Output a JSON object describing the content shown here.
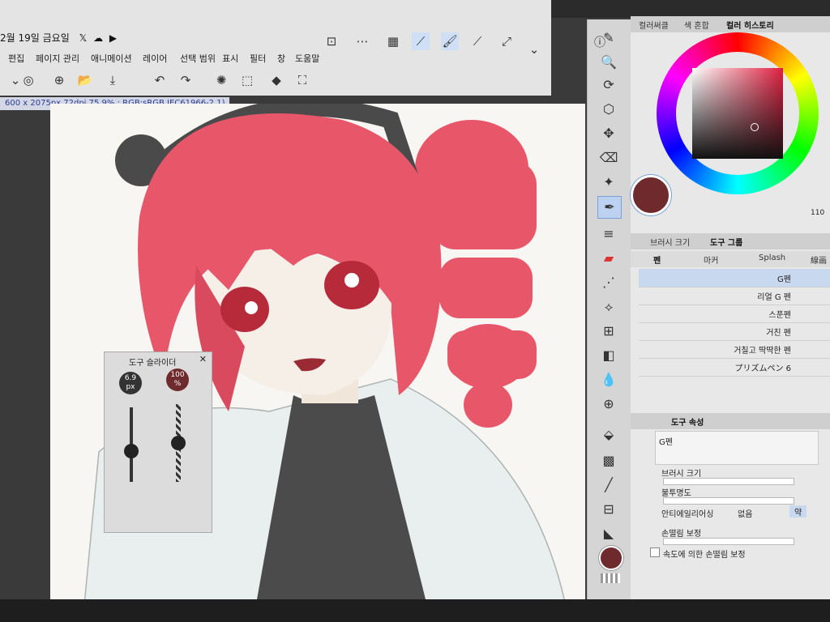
{
  "header": {
    "date": "2월 19일 금요일",
    "status_icons": [
      "x-icon",
      "cloud-icon",
      "youtube-icon"
    ]
  },
  "menu": [
    "편집",
    "페이지 관리",
    "애니메이션",
    "레이어",
    "선택 범위",
    "표시",
    "필터",
    "창",
    "도움말"
  ],
  "canvas_info": "600 x 2075px 72dpi 75.9% : RGB:sRGB IEC61966-2.1)",
  "tool_slider": {
    "title": "도구 슬라이더",
    "size_value": "6.9",
    "size_unit": "px",
    "opacity_value": "100",
    "opacity_unit": "%",
    "size_level": 0.4,
    "opacity_level": 1.0
  },
  "color_panel": {
    "tabs": [
      "컬러써클",
      "색 혼합",
      "컬러 히스토리"
    ],
    "selected_tab": "컬러 히스토리",
    "value_readout": "110",
    "main_color": "#6e2a2c",
    "ring_colors": [
      "#ff0000",
      "#ffff00",
      "#00ff00",
      "#00ffff",
      "#0000ff",
      "#ff00ff",
      "#ff0000"
    ]
  },
  "brush_panel": {
    "tabs": [
      "브러시 크기",
      "도구 그룹"
    ],
    "group_tabs": [
      "펜",
      "마커",
      "Splash",
      "線画"
    ],
    "brushes": [
      {
        "name": "G펜",
        "selected": true
      },
      {
        "name": "리얼 G 펜",
        "selected": false
      },
      {
        "name": "스푼펜",
        "selected": false
      },
      {
        "name": "거친 펜",
        "selected": false
      },
      {
        "name": "거칠고 딱딱한 펜",
        "selected": false
      },
      {
        "name": "プリズムペン 6",
        "selected": false
      }
    ]
  },
  "tool_property": {
    "title": "도구 속성",
    "brush_name": "G펜",
    "labels": {
      "brush_size": "브러시 크기",
      "opacity": "불투명도",
      "antialias": "안티에일리어싱",
      "antialias_none": "없음",
      "antialias_weak": "약",
      "stabilization": "손떨림 보정",
      "speed_stabilization": "속도에 의한 손떨림 보정"
    }
  },
  "colors": {
    "hair": "#e8566a",
    "hair_dark": "#c9364e",
    "outline": "#4a4a4a",
    "skin": "#f5efe8",
    "eye": "#b62a3a",
    "shirt": "#4b4b4b",
    "coat": "#e9eeee",
    "accent": "#7aa0d8"
  }
}
